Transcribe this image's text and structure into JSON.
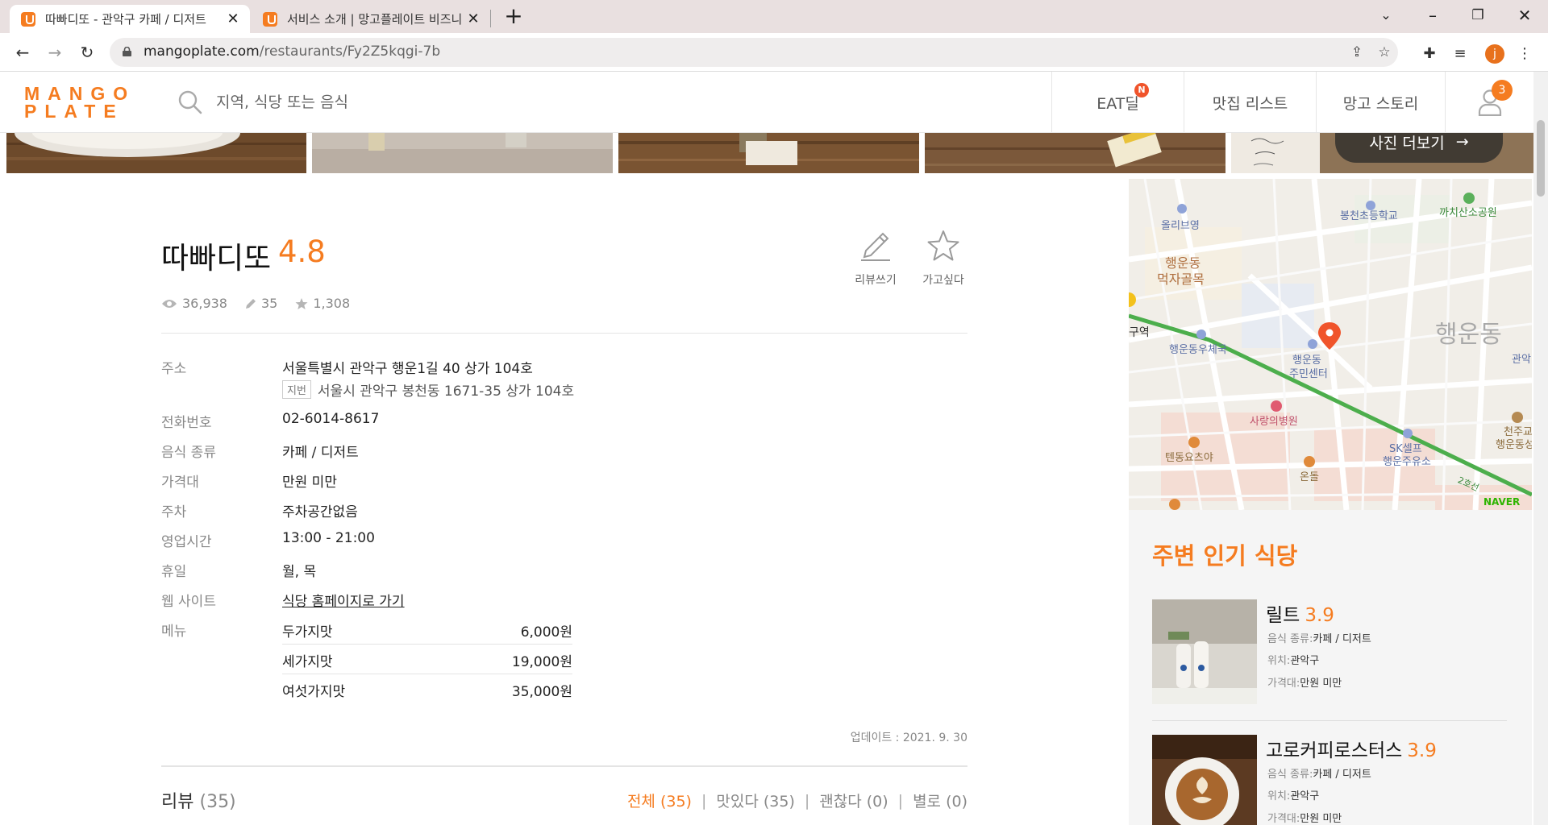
{
  "browser": {
    "tabs": [
      {
        "title": "따빠디또 - 관악구 카페 / 디저트",
        "active": true
      },
      {
        "title": "서비스 소개 | 망고플레이트 비즈니스",
        "active": false
      }
    ],
    "url_domain": "mangoplate.com",
    "url_path": "/restaurants/Fy2Z5kqgi-7b",
    "profile_initial": "j"
  },
  "header": {
    "logo_line1": "MANGO",
    "logo_line2": "PLATE",
    "search_placeholder": "지역, 식당 또는 음식",
    "nav": [
      {
        "label": "EAT딜",
        "badge": "N"
      },
      {
        "label": "맛집 리스트"
      },
      {
        "label": "망고 스토리"
      }
    ],
    "user_badge": "3"
  },
  "photos": {
    "more_label": "사진 더보기"
  },
  "restaurant": {
    "name": "따빠디또",
    "score": "4.8",
    "actions": {
      "review": "리뷰쓰기",
      "wishlist": "가고싶다"
    },
    "stats": {
      "views": "36,938",
      "reviews": "35",
      "wishes": "1,308"
    },
    "info": {
      "address_label": "주소",
      "address": "서울특별시 관악구 행운1길 40 상가 104호",
      "jibun_tag": "지번",
      "jibun_address": "서울시 관악구 봉천동 1671-35 상가 104호",
      "phone_label": "전화번호",
      "phone": "02-6014-8617",
      "food_type_label": "음식 종류",
      "food_type": "카페 / 디저트",
      "price_label": "가격대",
      "price": "만원 미만",
      "parking_label": "주차",
      "parking": "주차공간없음",
      "hours_label": "영업시간",
      "hours": "13:00 - 21:00",
      "holiday_label": "휴일",
      "holiday": "월, 목",
      "website_label": "웹 사이트",
      "website_link": "식당 홈페이지로 가기",
      "menu_label": "메뉴"
    },
    "menu": [
      {
        "name": "두가지맛",
        "price": "6,000원"
      },
      {
        "name": "세가지맛",
        "price": "19,000원"
      },
      {
        "name": "여섯가지맛",
        "price": "35,000원"
      }
    ],
    "updated": "업데이트 : 2021. 9. 30",
    "reviews": {
      "title": "리뷰",
      "count": "(35)",
      "filters": [
        {
          "label": "전체 (35)",
          "active": true
        },
        {
          "label": "맛있다 (35)",
          "active": false
        },
        {
          "label": "괜찮다 (0)",
          "active": false
        },
        {
          "label": "별로 (0)",
          "active": false
        }
      ]
    }
  },
  "map": {
    "labels": {
      "oliveyoung": "올리브영",
      "school": "봉천초등학교",
      "park": "까치산소공원",
      "food_alley": "행운동\n먹자골목",
      "station": "구역",
      "post_office": "행운동우체국",
      "community_center": "행운동\n주민센터",
      "district": "행운동",
      "gwanak": "관악",
      "hospital": "사랑의병원",
      "sk": "SK셀프\n행운주유소",
      "cheonju": "천주교\n행운동성",
      "tendon": "텐동요츠야",
      "ondol": "온돌",
      "line2": "2호선",
      "naver": "NAVER"
    }
  },
  "nearby": {
    "title": "주변 인기 식당",
    "food_type_label": "음식 종류:",
    "location_label": "위치:",
    "price_label": "가격대:",
    "items": [
      {
        "name": "릴트",
        "score": "3.9",
        "food_type": "카페 / 디저트",
        "location": "관악구",
        "price": "만원 미만"
      },
      {
        "name": "고로커피로스터스",
        "score": "3.9",
        "food_type": "카페 / 디저트",
        "location": "관악구",
        "price": "만원 미만"
      }
    ]
  },
  "colors": {
    "brand": "#f57c20",
    "map_green": "#4cae4c",
    "badge_red": "#f0542b"
  }
}
